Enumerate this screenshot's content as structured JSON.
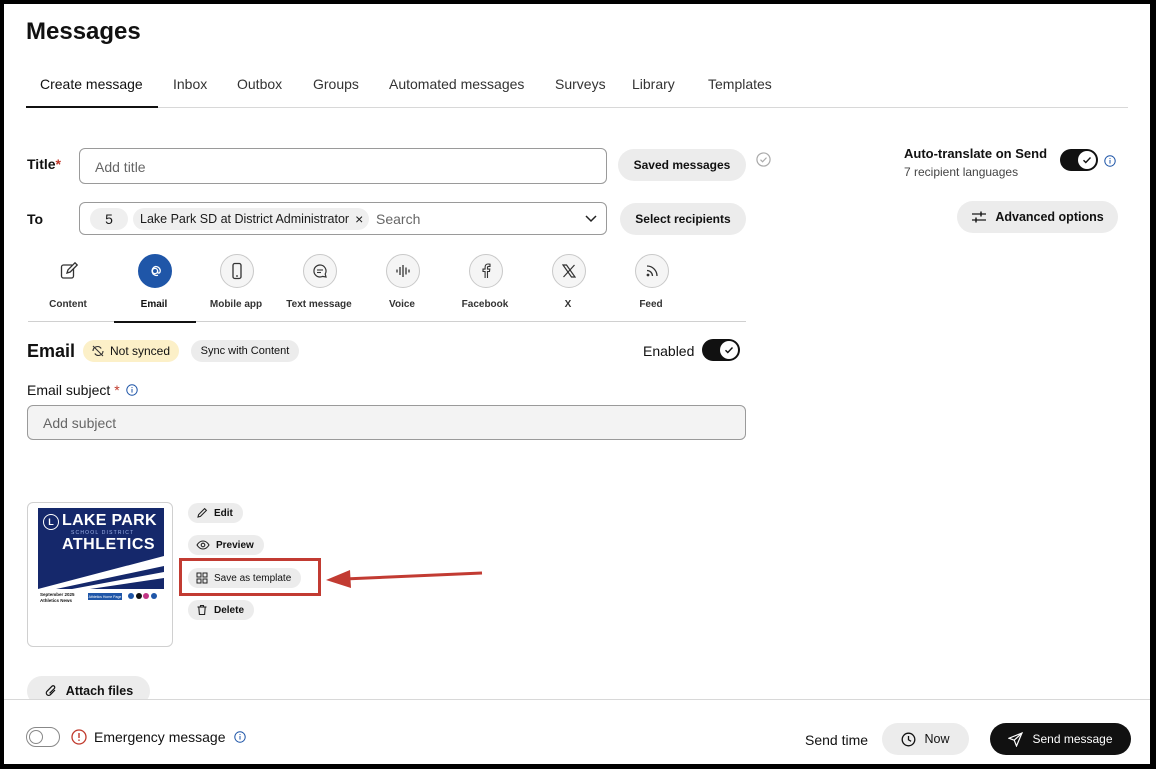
{
  "page_title": "Messages",
  "tabs": [
    {
      "label": "Create message",
      "active": true
    },
    {
      "label": "Inbox"
    },
    {
      "label": "Outbox"
    },
    {
      "label": "Groups"
    },
    {
      "label": "Automated messages"
    },
    {
      "label": "Surveys"
    },
    {
      "label": "Library"
    },
    {
      "label": "Templates"
    }
  ],
  "title_field": {
    "label": "Title",
    "required_mark": "*",
    "placeholder": "Add title"
  },
  "saved_messages_label": "Saved messages",
  "auto_translate": {
    "label": "Auto-translate on Send",
    "sub": "7 recipient languages",
    "enabled": true
  },
  "advanced_options_label": "Advanced options",
  "to_field": {
    "label": "To",
    "count": "5",
    "chip": "Lake Park SD at District Administrator",
    "chip_remove": "×",
    "placeholder": "Search"
  },
  "select_recipients_label": "Select recipients",
  "channels": [
    {
      "label": "Content",
      "icon": "edit-square-icon"
    },
    {
      "label": "Email",
      "icon": "at-sign-icon",
      "active": true
    },
    {
      "label": "Mobile app",
      "icon": "mobile-phone-icon"
    },
    {
      "label": "Text message",
      "icon": "chat-bubble-icon"
    },
    {
      "label": "Voice",
      "icon": "waveform-icon"
    },
    {
      "label": "Facebook",
      "icon": "facebook-icon"
    },
    {
      "label": "X",
      "icon": "x-logo-icon"
    },
    {
      "label": "Feed",
      "icon": "rss-feed-icon"
    }
  ],
  "email_section": {
    "title": "Email",
    "not_synced": "Not synced",
    "sync_button": "Sync with Content",
    "enabled_label": "Enabled",
    "subject_label": "Email subject",
    "subject_required": "*",
    "subject_placeholder": "Add subject"
  },
  "thumbnail": {
    "line1": "LAKE PARK",
    "line2": "SCHOOL DISTRICT",
    "line3": "ATHLETICS",
    "footer_left": "September 2025 Athletics News",
    "footer_button": "Athletics Home Page"
  },
  "template_actions": [
    {
      "label": "Edit",
      "icon": "pencil-icon"
    },
    {
      "label": "Preview",
      "icon": "eye-icon"
    },
    {
      "label": "Save as template",
      "icon": "grid-icon",
      "highlighted": true
    },
    {
      "label": "Delete",
      "icon": "trash-icon"
    }
  ],
  "attach_files_label": "Attach files",
  "footer": {
    "emergency_label": "Emergency message",
    "send_time_label": "Send time",
    "now_label": "Now",
    "send_label": "Send message"
  },
  "colors": {
    "accent_blue": "#1f56a8",
    "annotation_red": "#c23b32",
    "dark": "#111111"
  }
}
